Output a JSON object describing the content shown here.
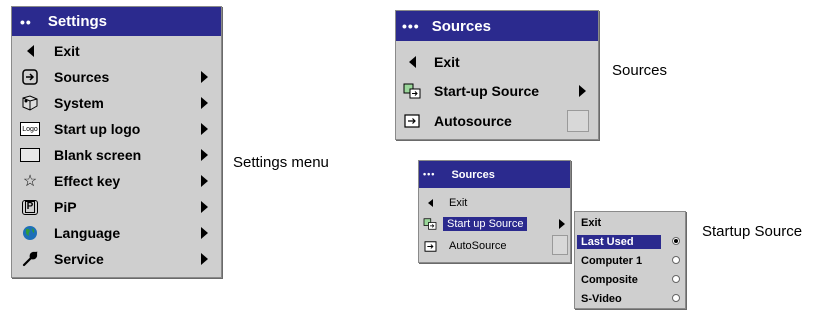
{
  "settings_menu": {
    "title": "Settings",
    "items": [
      {
        "label": "Exit",
        "icon": "back-arrow-icon"
      },
      {
        "label": "Sources",
        "icon": "source-icon"
      },
      {
        "label": "System",
        "icon": "system-icon"
      },
      {
        "label": "Start up logo",
        "icon": "logo-icon",
        "icon_text": "Logo"
      },
      {
        "label": "Blank screen",
        "icon": "blank-screen-icon"
      },
      {
        "label": "Effect key",
        "icon": "star-icon"
      },
      {
        "label": "PiP",
        "icon": "pip-icon",
        "icon_text": "P"
      },
      {
        "label": "Language",
        "icon": "globe-icon"
      },
      {
        "label": "Service",
        "icon": "wrench-icon"
      }
    ],
    "caption": "Settings menu"
  },
  "sources_menu": {
    "title": "Sources",
    "items": [
      {
        "label": "Exit",
        "icon": "back-arrow-icon"
      },
      {
        "label": "Start-up Source",
        "icon": "startup-source-icon"
      },
      {
        "label": "Autosource",
        "icon": "autosource-icon"
      }
    ],
    "caption": "Sources"
  },
  "startup_menu": {
    "title": "Sources",
    "items": [
      {
        "label": "Exit",
        "icon": "back-arrow-icon"
      },
      {
        "label": "Start up Source",
        "icon": "startup-source-icon",
        "selected": true
      },
      {
        "label": "AutoSource",
        "icon": "autosource-icon"
      }
    ],
    "submenu": {
      "items": [
        {
          "label": "Exit"
        },
        {
          "label": "Last Used",
          "selected": true
        },
        {
          "label": "Computer 1"
        },
        {
          "label": "Composite"
        },
        {
          "label": "S-Video"
        }
      ]
    },
    "caption": "Startup Source"
  },
  "colors": {
    "title_bar": "#2b2a8e",
    "menu_bg": "#cfcfcf",
    "highlight": "#2b2a8e"
  }
}
